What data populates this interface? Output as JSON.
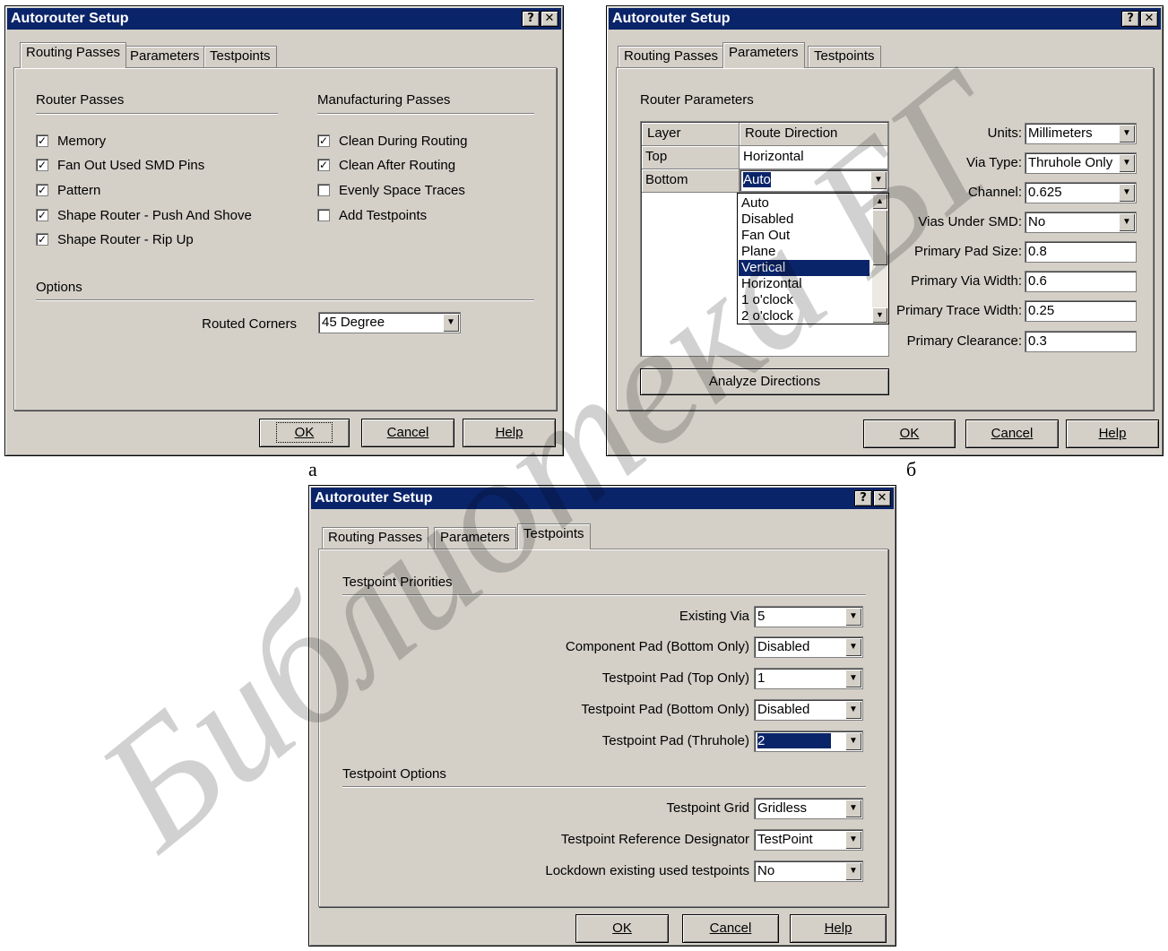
{
  "window_title": "Autorouter Setup",
  "title_buttons": {
    "help": "?",
    "close": "✕"
  },
  "tabs": {
    "routing": "Routing Passes",
    "parameters": "Parameters",
    "testpoints": "Testpoints"
  },
  "dialog_buttons": {
    "ok": "OK",
    "cancel": "Cancel",
    "help": "Help"
  },
  "captions": {
    "a": "а",
    "b": "б"
  },
  "watermark": "Библиотека БГ",
  "icons": {
    "checkmark": "check-icon",
    "dropdown": "chevron-down-icon",
    "scroll_up": "scroll-up-icon",
    "scroll_down": "scroll-down-icon"
  },
  "colors": {
    "titlebar": "#0a246a",
    "face": "#d4d0c8",
    "selection": "#0a246a"
  },
  "dialog_a": {
    "router_passes_title": "Router Passes",
    "router_passes": [
      {
        "label": "Memory",
        "checked": true
      },
      {
        "label": "Fan Out Used SMD Pins",
        "checked": true
      },
      {
        "label": "Pattern",
        "checked": true
      },
      {
        "label": "Shape Router - Push And Shove",
        "checked": true
      },
      {
        "label": "Shape Router - Rip Up",
        "checked": true
      }
    ],
    "manufacturing_passes_title": "Manufacturing Passes",
    "manufacturing_passes": [
      {
        "label": "Clean During Routing",
        "checked": true
      },
      {
        "label": "Clean After Routing",
        "checked": true
      },
      {
        "label": "Evenly Space Traces",
        "checked": false
      },
      {
        "label": "Add Testpoints",
        "checked": false
      }
    ],
    "options_title": "Options",
    "routed_corners_label": "Routed Corners",
    "routed_corners_value": "45 Degree"
  },
  "dialog_b": {
    "router_parameters_title": "Router Parameters",
    "grid_headers": {
      "layer": "Layer",
      "direction": "Route Direction"
    },
    "rows": [
      {
        "layer": "Top",
        "direction": "Horizontal"
      },
      {
        "layer": "Bottom",
        "direction": "Auto"
      }
    ],
    "direction_options": [
      "Auto",
      "Disabled",
      "Fan Out",
      "Plane",
      "Vertical",
      "Horizontal",
      "1 o'clock",
      "2 o'clock"
    ],
    "highlighted_option": "Vertical",
    "analyze_button": "Analyze Directions",
    "params": {
      "units_label": "Units:",
      "units_value": "Millimeters",
      "via_type_label": "Via Type:",
      "via_type_value": "Thruhole Only",
      "channel_label": "Channel:",
      "channel_value": "0.625",
      "vias_under_smd_label": "Vias Under SMD:",
      "vias_under_smd_value": "No",
      "pad_size_label": "Primary Pad Size:",
      "pad_size_value": "0.8",
      "via_width_label": "Primary Via Width:",
      "via_width_value": "0.6",
      "trace_width_label": "Primary Trace Width:",
      "trace_width_value": "0.25",
      "clearance_label": "Primary Clearance:",
      "clearance_value": "0.3"
    }
  },
  "dialog_c": {
    "priorities_title": "Testpoint Priorities",
    "existing_via_label": "Existing Via",
    "existing_via_value": "5",
    "component_pad_label": "Component Pad (Bottom Only)",
    "component_pad_value": "Disabled",
    "tp_top_label": "Testpoint Pad (Top Only)",
    "tp_top_value": "1",
    "tp_bottom_label": "Testpoint Pad (Bottom Only)",
    "tp_bottom_value": "Disabled",
    "tp_thru_label": "Testpoint Pad (Thruhole)",
    "tp_thru_value": "2",
    "options_title": "Testpoint Options",
    "grid_label": "Testpoint Grid",
    "grid_value": "Gridless",
    "refdes_label": "Testpoint Reference Designator",
    "refdes_value": "TestPoint",
    "lockdown_label": "Lockdown existing used testpoints",
    "lockdown_value": "No"
  }
}
